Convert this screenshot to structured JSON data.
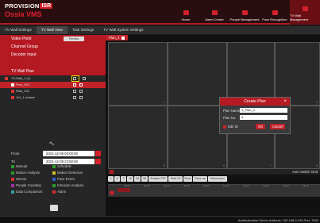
{
  "app": {
    "brand": "PROVISION",
    "brand_box": "ISR",
    "sub": "Ossia VMS"
  },
  "topnav": [
    {
      "label": "Home"
    },
    {
      "label": "Alarm Center"
    },
    {
      "label": "People Management"
    },
    {
      "label": "Face Recognition"
    },
    {
      "label": "TV Wall Management"
    }
  ],
  "tabs": [
    "TV Wall Settings",
    "TV Wall View",
    "Task Settings",
    "TV Wall System Settings"
  ],
  "menu": {
    "video_point": "Video Point",
    "preview": "Preview",
    "channel_group": "Channel Group",
    "decoder_input": "Decoder Input",
    "tv_wall_plan": "TV Wall Plan"
  },
  "tree": [
    {
      "label": "TV-Wall_1 (1)"
    },
    {
      "label": "Plan_003"
    },
    {
      "label": "Plan_101"
    },
    {
      "label": "1x1_1 mvanv"
    }
  ],
  "dates": {
    "from_label": "From",
    "from_value": "2021-12-08 00:00:00",
    "to_label": "To",
    "to_value": "2021-12-08 23:59:59"
  },
  "events": [
    {
      "label": "Manual",
      "color": "#2a9c2a"
    },
    {
      "label": "Schedule",
      "color": "#2a9c2a"
    },
    {
      "label": "Motion Analysis",
      "color": "#2a9c2a"
    },
    {
      "label": "Motion Detection",
      "color": "#d3c020"
    },
    {
      "label": "Sensor",
      "color": "#d33030"
    },
    {
      "label": "Face Event",
      "color": "#3060d0"
    },
    {
      "label": "People Counting",
      "color": "#a030a0"
    },
    {
      "label": "Intrusion Analysis",
      "color": "#2a9c2a"
    },
    {
      "label": "Data Comparison",
      "color": "#3a9c9c"
    },
    {
      "label": "Alarm",
      "color": "#d33030"
    }
  ],
  "plan_tab": "Plan_3",
  "grid_numbers": [
    "1",
    "2",
    "3",
    "4",
    "5",
    "6",
    "7",
    "8"
  ],
  "dialog": {
    "title": "Create Plan",
    "close": "×",
    "plan_name_label": "Plan Name",
    "plan_name_value": "1_Plan_4",
    "plan_no_label": "Plan No.",
    "plan_no_value": "4",
    "edit_id": "Edit ID",
    "ok": "OK",
    "cancel": "Cancel"
  },
  "timeline": {
    "auto_switch": "Auto Switch Grid",
    "buttons": [
      "1",
      "4",
      "9",
      "16",
      "25",
      "36",
      "Enable PIP",
      "Hide ID",
      "Save",
      "Save as",
      "Renumber"
    ],
    "ticks": [
      "00:00",
      "02:00",
      "04:00",
      "06:00",
      "08:00",
      "10:00",
      "12:00",
      "14:00",
      "16:00",
      "18:00"
    ]
  },
  "status": "Authentication Server  Address: 192.168.0.190    Port: 7000"
}
